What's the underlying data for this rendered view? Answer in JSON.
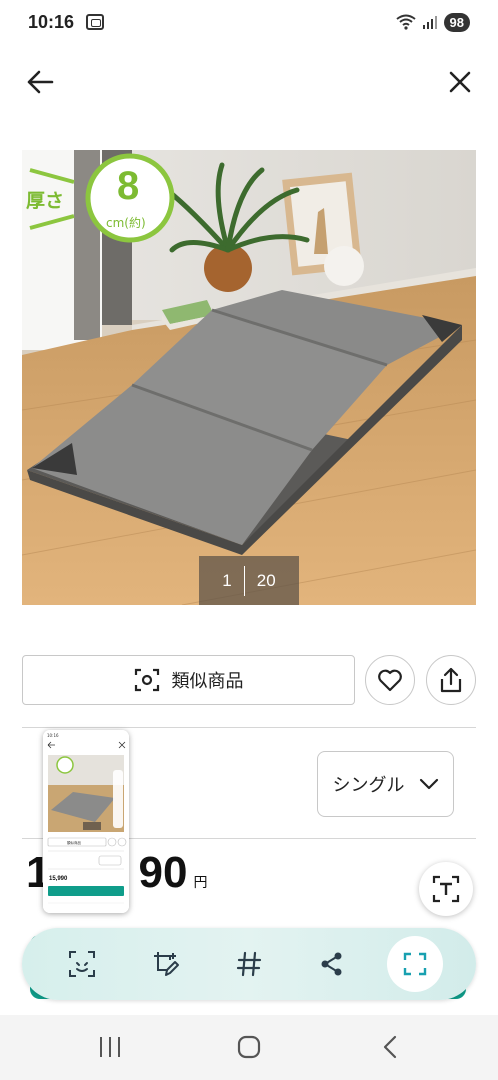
{
  "status_bar": {
    "time": "10:16",
    "battery": "98"
  },
  "gallery": {
    "current": "1",
    "total": "20",
    "badge_label": "厚さ",
    "badge_number": "8",
    "badge_unit": "cm(約)"
  },
  "actions": {
    "similar_label": "類似商品"
  },
  "size": {
    "selected": "シングル"
  },
  "price": {
    "visible_left": "1",
    "visible_right": "90",
    "currency": "円"
  },
  "thumbnail": {
    "price": "15,990",
    "similar": "類似商品"
  },
  "colors": {
    "accent_green": "#0f9d8a",
    "badge_green": "#8cc63f"
  }
}
